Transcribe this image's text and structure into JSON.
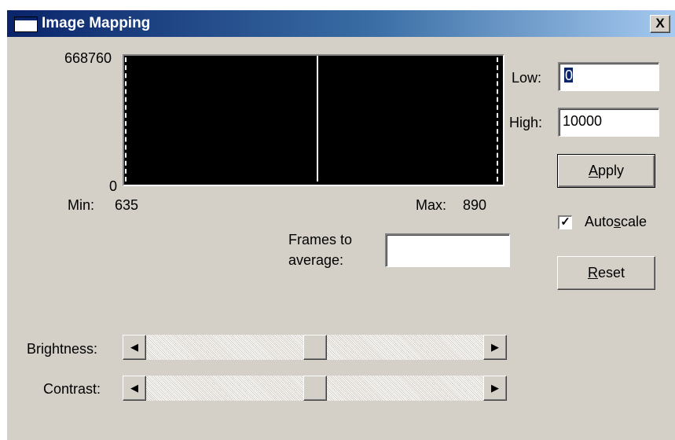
{
  "window": {
    "title": "Image Mapping",
    "close_label": "X"
  },
  "histogram": {
    "y_max_label": "668760",
    "y_min_label": "0",
    "min_label": "Min:",
    "min_value": "635",
    "max_label": "Max:",
    "max_value": "890"
  },
  "mapping": {
    "low_label": "Low:",
    "low_value": "0",
    "high_label": "High:",
    "high_value": "10000"
  },
  "buttons": {
    "apply_label": "Apply",
    "reset_label": "Reset"
  },
  "autoscale": {
    "label": "Autoscale",
    "checked": true
  },
  "frames": {
    "label_line1": "Frames to",
    "label_line2": "average:",
    "value": ""
  },
  "sliders": {
    "brightness_label": "Brightness:",
    "brightness_level": 0.5,
    "contrast_label": "Contrast:",
    "contrast_level": 0.5
  },
  "colors": {
    "titlebar_start": "#0a246a",
    "titlebar_end": "#a6caf0",
    "dialog_face": "#d4d0c8",
    "histogram_bg": "#000000",
    "histogram_line": "#ffffff"
  },
  "icons": {
    "title": "window-icon",
    "close": "close-icon",
    "slider_left": "arrow-left-icon",
    "slider_right": "arrow-right-icon",
    "checkbox": "checkmark-icon"
  }
}
